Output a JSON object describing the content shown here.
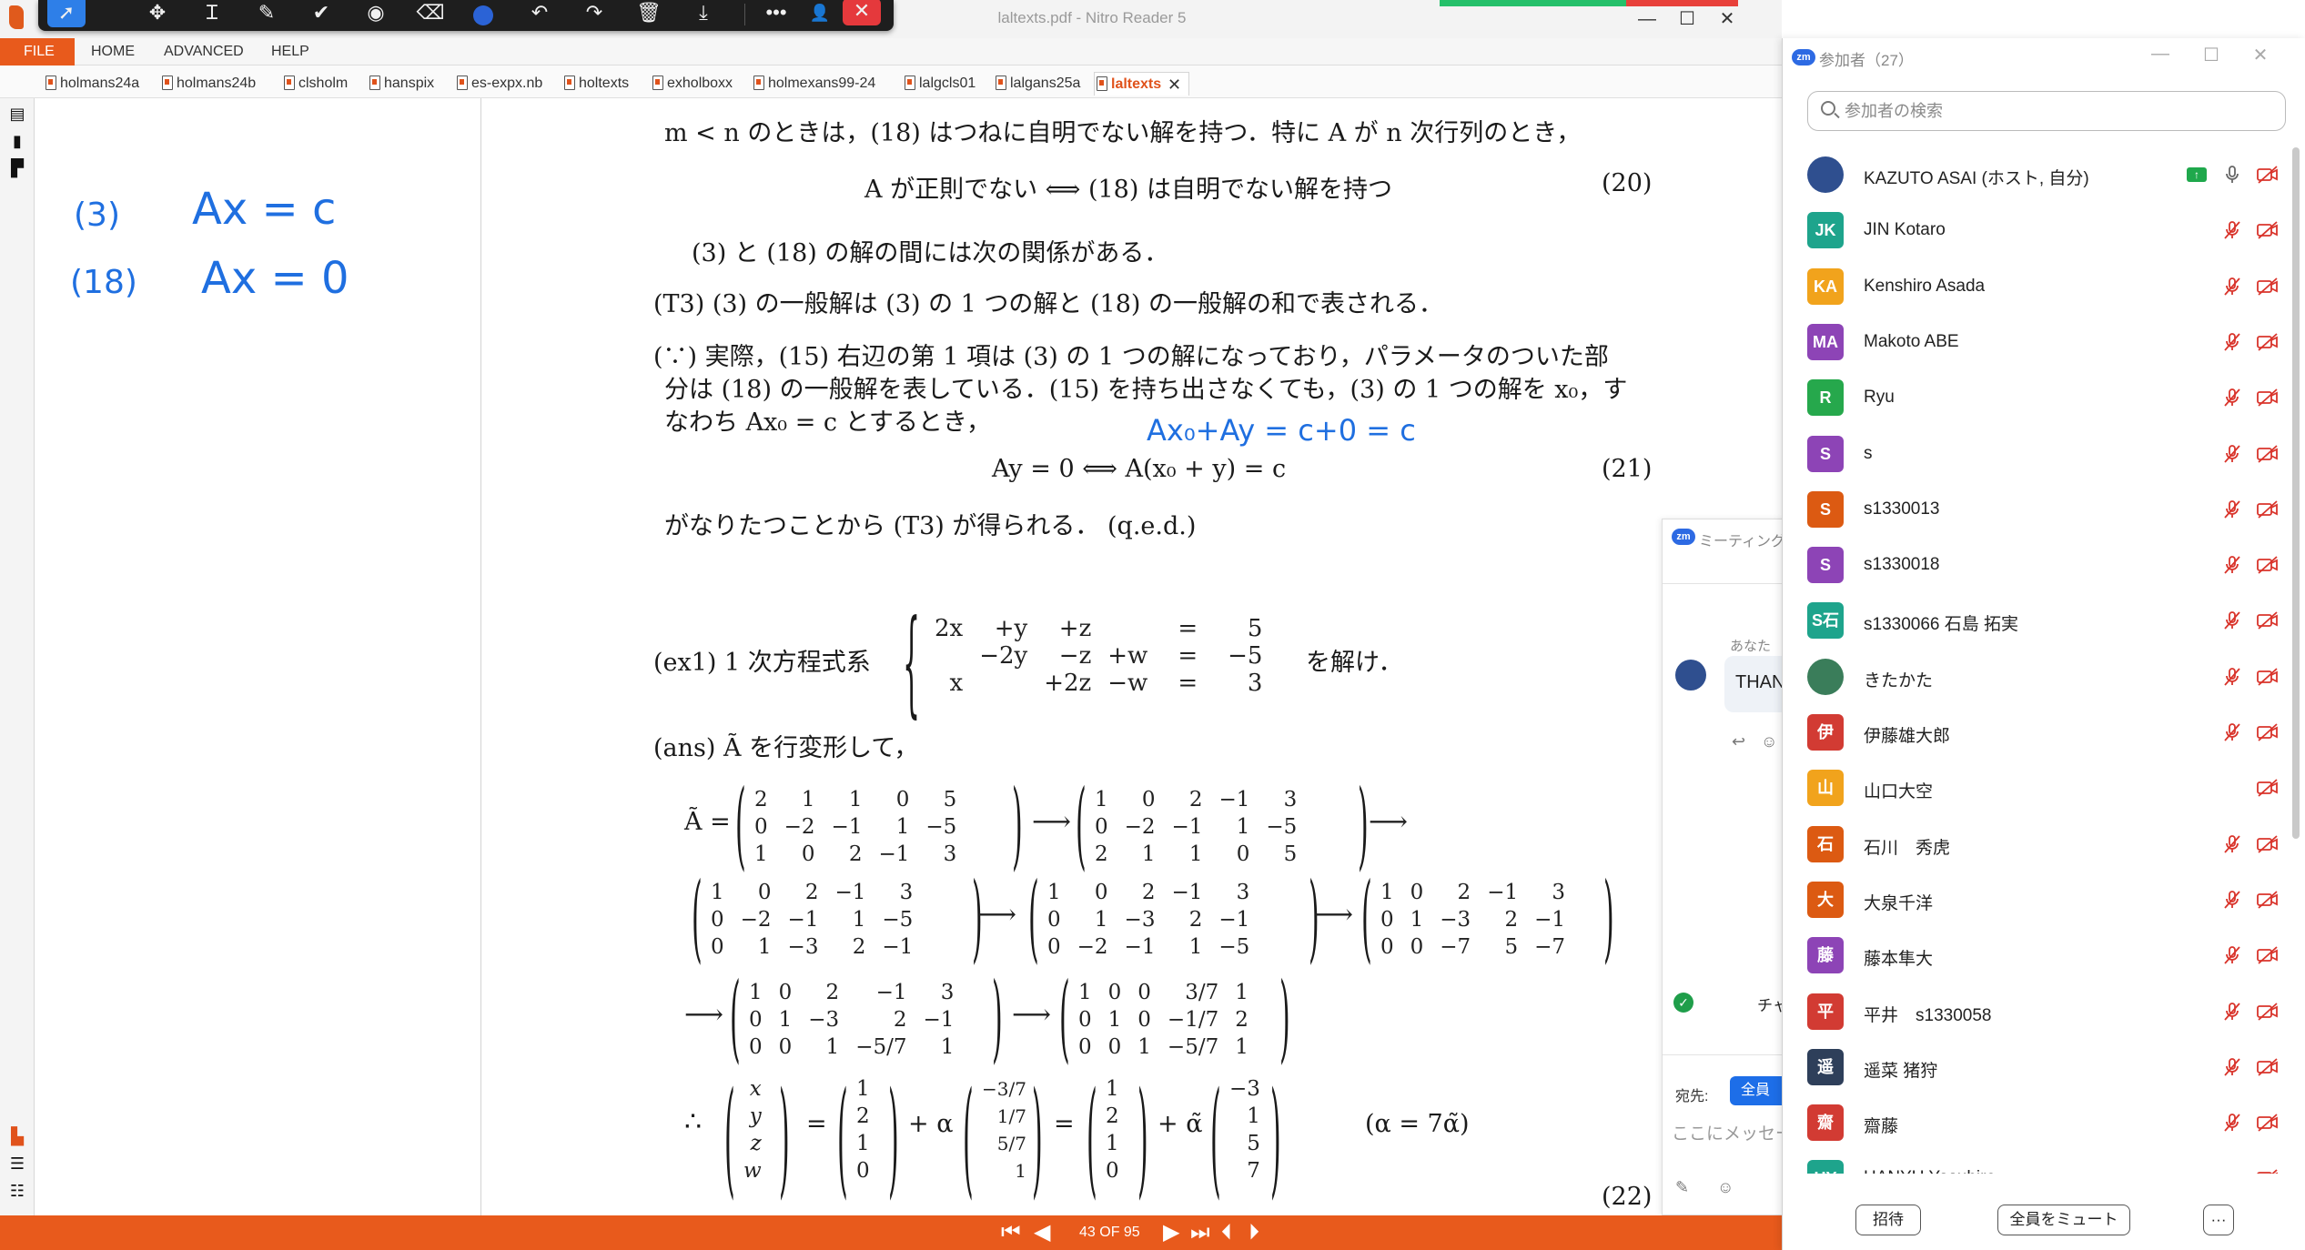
{
  "window": {
    "title": "laltexts.pdf - Nitro Reader 5",
    "controls": {
      "minimize": "—",
      "maximize": "☐",
      "close": "✕"
    }
  },
  "menu": {
    "file": "FILE",
    "items": [
      "HOME",
      "ADVANCED",
      "HELP"
    ]
  },
  "doc_tabs": [
    "holmans24a",
    "holmans24b",
    "clsholm",
    "hanspix",
    "es-expx.nb",
    "holtexts",
    "exholboxx",
    "holmexans99-24",
    "lalgcls01",
    "lalgans25a",
    "laltexts"
  ],
  "active_tab": "laltexts",
  "annotation_toolbar": {
    "icons": [
      "select-arrow-icon",
      "move-icon",
      "text-cursor-icon",
      "pen-icon",
      "checkmark-icon",
      "stamp-icon",
      "eraser-icon",
      "color-dot-icon",
      "undo-icon",
      "redo-icon",
      "trash-icon",
      "download-icon",
      "more-icon",
      "user-settings-icon",
      "close-icon"
    ],
    "ink_color": "#2b63d6"
  },
  "ink_notes": {
    "line1_label": "(3)",
    "line1_eq": "Ax = c",
    "line2_label": "(18)",
    "line2_eq": "Ax = 0",
    "doc_note": "Ax₀+Ay = c+0 = c"
  },
  "document": {
    "line1": "m < n のときは，(18) はつねに自明でない解を持つ．特に A が n 次行列のとき，",
    "eq20": "A が正則でない  ⟺  (18) は自明でない解を持つ",
    "eq20_num": "(20)",
    "line3": "(3) と (18) の解の間には次の関係がある．",
    "t3": "(T3)  (3) の一般解は (3) の 1 つの解と (18) の一般解の和で表される．",
    "proof1": "(∵)  実際，(15) 右辺の第 1 項は (3) の 1 つの解になっており，パラメータのついた部",
    "proof2": "分は (18) の一般解を表している．(15) を持ち出さなくても，(3) の 1 つの解を x₀，す",
    "proof3": "なわち  Ax₀ = c  とするとき，",
    "eq21": "Ay = 0  ⟺  A(x₀ + y) = c",
    "eq21_num": "(21)",
    "qed": "がなりたつことから (T3) が得られる．  (q.e.d.)",
    "ex1_label": "(ex1)  1 次方程式系",
    "ex1_rows": [
      [
        "2x",
        "+y",
        "+z",
        "",
        "=",
        "5"
      ],
      [
        "",
        "−2y",
        "−z",
        "+w",
        "=",
        "−5"
      ],
      [
        "x",
        "",
        "+2z",
        "−w",
        "=",
        "3"
      ]
    ],
    "ex1_tail": "を解け．",
    "ans": "(ans)  Ã を行変形して，",
    "atilde": "Ã =",
    "matrices": {
      "m1": [
        [
          "2",
          "1",
          "1",
          "0",
          "5"
        ],
        [
          "0",
          "−2",
          "−1",
          "1",
          "−5"
        ],
        [
          "1",
          "0",
          "2",
          "−1",
          "3"
        ]
      ],
      "m2": [
        [
          "1",
          "0",
          "2",
          "−1",
          "3"
        ],
        [
          "0",
          "−2",
          "−1",
          "1",
          "−5"
        ],
        [
          "2",
          "1",
          "1",
          "0",
          "5"
        ]
      ],
      "m3": [
        [
          "1",
          "0",
          "2",
          "−1",
          "3"
        ],
        [
          "0",
          "−2",
          "−1",
          "1",
          "−5"
        ],
        [
          "0",
          "1",
          "−3",
          "2",
          "−1"
        ]
      ],
      "m4": [
        [
          "1",
          "0",
          "2",
          "−1",
          "3"
        ],
        [
          "0",
          "1",
          "−3",
          "2",
          "−1"
        ],
        [
          "0",
          "−2",
          "−1",
          "1",
          "−5"
        ]
      ],
      "m5": [
        [
          "1",
          "0",
          "2",
          "−1",
          "3"
        ],
        [
          "0",
          "1",
          "−3",
          "2",
          "−1"
        ],
        [
          "0",
          "0",
          "−7",
          "5",
          "−7"
        ]
      ],
      "m6": [
        [
          "1",
          "0",
          "2",
          "−1",
          "3"
        ],
        [
          "0",
          "1",
          "−3",
          "2",
          "−1"
        ],
        [
          "0",
          "0",
          "1",
          "−5/7",
          "1"
        ]
      ],
      "m7": [
        [
          "1",
          "0",
          "0",
          "3/7",
          "1"
        ],
        [
          "0",
          "1",
          "0",
          "−1/7",
          "2"
        ],
        [
          "0",
          "0",
          "1",
          "−5/7",
          "1"
        ]
      ]
    },
    "arrow": "⟶",
    "therefore": "∴",
    "vec_xyzw": [
      "x",
      "y",
      "z",
      "w"
    ],
    "vec_a": [
      "1",
      "2",
      "1",
      "0"
    ],
    "vec_b": [
      "−3/7",
      "1/7",
      "5/7",
      "1"
    ],
    "vec_c": [
      "1",
      "2",
      "1",
      "0"
    ],
    "vec_d": [
      "−3",
      "1",
      "5",
      "7"
    ],
    "plus_alpha": "+ α",
    "plus_alpha_t": "+ α̃",
    "equals": "=",
    "alpha_def": "(α = 7α̃)",
    "eq22_num": "(22)"
  },
  "status": {
    "page_indicator": "43 OF 95",
    "progress_green": 0.5,
    "progress_red": 0.3
  },
  "chat": {
    "title": "ミーティング チ",
    "from_label": "あなた",
    "message": "THAN",
    "notice": "チャ",
    "to_label": "宛先:",
    "to_value": "全員",
    "input_placeholder": "ここにメッセー"
  },
  "participants": {
    "title": "参加者（27）",
    "search_placeholder": "参加者の検索",
    "people": [
      {
        "initials": "",
        "name": "KAZUTO ASAI (ホスト, 自分)",
        "color": "#2f4f8f",
        "mic": "on",
        "host": true
      },
      {
        "initials": "JK",
        "name": "JIN Kotaro",
        "color": "#1ea48c",
        "mic": "muted"
      },
      {
        "initials": "KA",
        "name": "Kenshiro Asada",
        "color": "#f1a31c",
        "mic": "muted"
      },
      {
        "initials": "MA",
        "name": "Makoto ABE",
        "color": "#8d44b6",
        "mic": "muted"
      },
      {
        "initials": "R",
        "name": "Ryu",
        "color": "#26a84c",
        "mic": "muted"
      },
      {
        "initials": "S",
        "name": "s",
        "color": "#8d44b6",
        "mic": "muted"
      },
      {
        "initials": "S",
        "name": "s1330013",
        "color": "#dc5a12",
        "mic": "muted"
      },
      {
        "initials": "S",
        "name": "s1330018",
        "color": "#8d44b6",
        "mic": "muted"
      },
      {
        "initials": "S石",
        "name": "s1330066 石島 拓実",
        "color": "#1ea48c",
        "mic": "muted"
      },
      {
        "initials": "",
        "name": "きたかた",
        "color": "#3a7d5a",
        "mic": "muted"
      },
      {
        "initials": "伊",
        "name": "伊藤雄大郎",
        "color": "#d23b33",
        "mic": "muted"
      },
      {
        "initials": "山",
        "name": "山口大空",
        "color": "#f1a31c",
        "mic": "none"
      },
      {
        "initials": "石",
        "name": "石川　秀虎",
        "color": "#dc5a12",
        "mic": "muted"
      },
      {
        "initials": "大",
        "name": "大泉千洋",
        "color": "#dc5a12",
        "mic": "muted"
      },
      {
        "initials": "藤",
        "name": "藤本隼大",
        "color": "#8d44b6",
        "mic": "muted"
      },
      {
        "initials": "平",
        "name": "平井　s1330058",
        "color": "#d23b33",
        "mic": "muted"
      },
      {
        "initials": "遥",
        "name": "遥菜 猪狩",
        "color": "#2e3f5a",
        "mic": "muted"
      },
      {
        "initials": "齋",
        "name": "齋藤",
        "color": "#d23b33",
        "mic": "muted"
      },
      {
        "initials": "HY",
        "name": "HANYU Yasuhiro",
        "color": "#1ea48c",
        "mic": "none"
      }
    ],
    "invite_label": "招待",
    "mute_all_label": "全員をミュート",
    "more_label": "···"
  }
}
